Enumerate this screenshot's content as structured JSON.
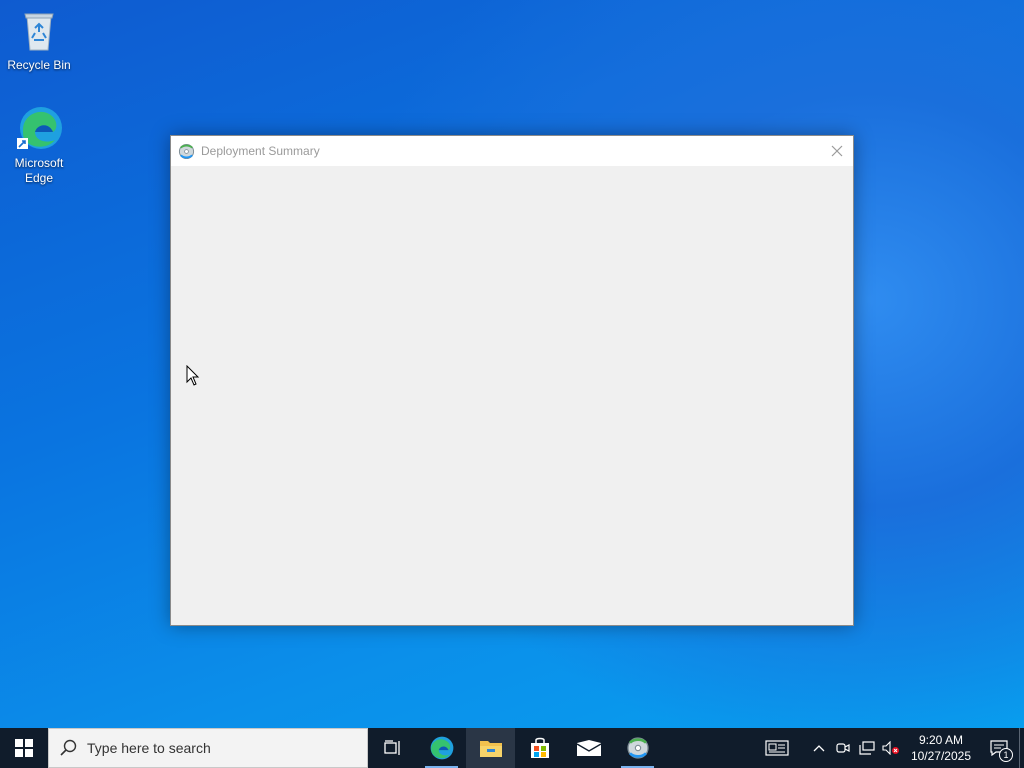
{
  "desktop": {
    "icons": [
      {
        "label": "Recycle Bin",
        "icon": "recycle-bin-icon"
      },
      {
        "label": "Microsoft\nEdge",
        "icon": "edge-icon"
      }
    ]
  },
  "window": {
    "title": "Deployment Summary",
    "icon": "deployment-app-icon",
    "close_icon": "close-icon"
  },
  "taskbar": {
    "search_placeholder": "Type here to search",
    "apps": [
      {
        "name": "task-view",
        "icon": "task-view-icon"
      },
      {
        "name": "edge",
        "icon": "edge-icon"
      },
      {
        "name": "file-explorer",
        "icon": "folder-icon"
      },
      {
        "name": "store",
        "icon": "store-icon"
      },
      {
        "name": "mail",
        "icon": "mail-icon"
      },
      {
        "name": "deployment",
        "icon": "deployment-app-icon"
      }
    ],
    "clock": {
      "time": "9:20 AM",
      "date": "10/27/2025"
    },
    "notification_count": "1"
  },
  "colors": {
    "taskbar": "#101c2b",
    "window_bg": "#f0f0f0",
    "active_indicator": "#7ab3ef"
  }
}
